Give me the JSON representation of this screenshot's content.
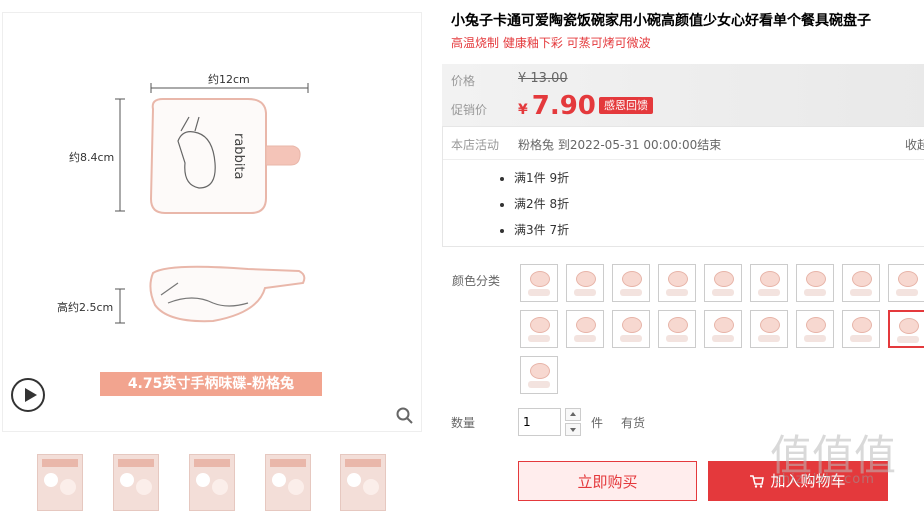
{
  "gallery": {
    "dim_width": "约12cm",
    "dim_length": "约8.4cm",
    "dim_height": "高约2.5cm",
    "dish_text": "rabbita",
    "caption": "4.75英寸手柄味碟-粉格兔",
    "play_icon": "play-icon",
    "zoom_icon": "magnifier-icon",
    "thumbnail_count": 5
  },
  "product": {
    "title": "小兔子卡通可爱陶瓷饭碗家用小碗高颜值少女心好看单个餐具碗盘子",
    "subtitle": "高温烧制 健康釉下彩 可蒸可烤可微波"
  },
  "price": {
    "price_label": "价格",
    "original": "¥ 13.00",
    "promo_label": "促销价",
    "currency": "¥",
    "promo_value": "7.90",
    "promo_tag": "感恩回馈"
  },
  "activity": {
    "label": "本店活动",
    "desc": "粉格兔 到2022-05-31 00:00:00结束",
    "collapse": "收起",
    "rules": [
      "满1件 9折",
      "满2件 8折",
      "满3件 7折"
    ]
  },
  "options": {
    "color_label": "颜色分类",
    "swatch_count": 19,
    "selected_index": 17
  },
  "quantity": {
    "label": "数量",
    "value": "1",
    "unit": "件",
    "stock": "有货"
  },
  "actions": {
    "buy_now": "立即购买",
    "add_cart": "加入购物车"
  },
  "watermark": {
    "logo": "值值值",
    "site": "zhizhizhi.com"
  },
  "colors": {
    "accent": "#e4393c",
    "caption_bg": "#f2a48f",
    "dish_pink": "#f7d8d0"
  }
}
